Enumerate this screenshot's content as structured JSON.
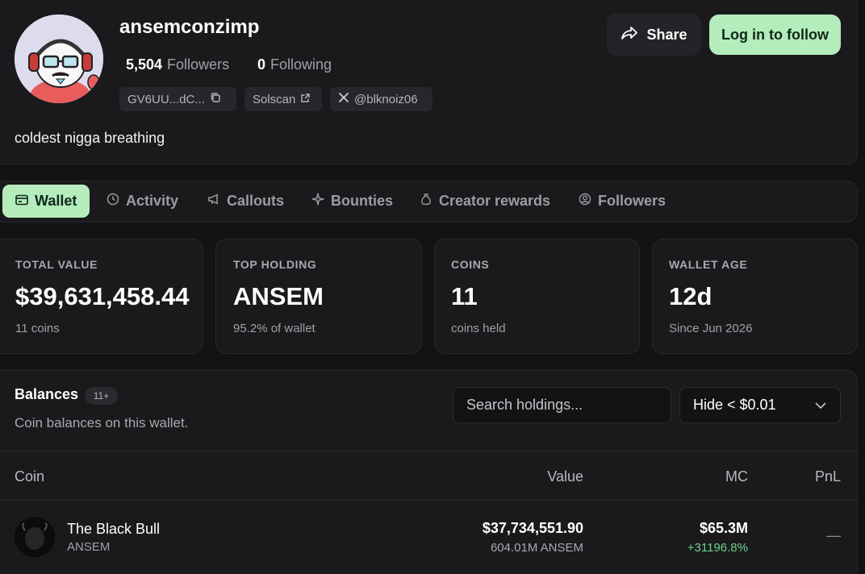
{
  "profile": {
    "username": "ansemconzimp",
    "followers_count": "5,504",
    "followers_label": "Followers",
    "following_count": "0",
    "following_label": "Following",
    "address": "GV6UU...dC...",
    "solscan_label": "Solscan",
    "x_handle": "@blknoiz06",
    "bio": "coldest nigga breathing"
  },
  "actions": {
    "share_label": "Share",
    "follow_label": "Log in to follow"
  },
  "tabs": [
    {
      "label": "Wallet",
      "icon": "wallet-icon",
      "active": true
    },
    {
      "label": "Activity",
      "icon": "clock-icon",
      "active": false
    },
    {
      "label": "Callouts",
      "icon": "megaphone-icon",
      "active": false
    },
    {
      "label": "Bounties",
      "icon": "sparkle-icon",
      "active": false
    },
    {
      "label": "Creator rewards",
      "icon": "money-bag-icon",
      "active": false
    },
    {
      "label": "Followers",
      "icon": "user-circle-icon",
      "active": false
    }
  ],
  "stats": [
    {
      "label": "TOTAL VALUE",
      "value": "$39,631,458.44",
      "sub": "11 coins"
    },
    {
      "label": "TOP HOLDING",
      "value": "ANSEM",
      "sub": "95.2% of wallet"
    },
    {
      "label": "COINS",
      "value": "11",
      "sub": "coins held"
    },
    {
      "label": "WALLET AGE",
      "value": "12d",
      "sub": "Since Jun 2026"
    }
  ],
  "balances": {
    "title": "Balances",
    "badge": "11+",
    "subtitle": "Coin balances on this wallet.",
    "search_placeholder": "Search holdings...",
    "filter_value": "Hide < $0.01",
    "columns": {
      "coin": "Coin",
      "value": "Value",
      "mc": "MC",
      "pnl": "PnL"
    },
    "rows": [
      {
        "name": "The Black Bull",
        "symbol": "ANSEM",
        "value": "$37,734,551.90",
        "amount": "604.01M ANSEM",
        "mc": "$65.3M",
        "mc_change": "+31196.8%",
        "pnl": "—"
      }
    ]
  },
  "colors": {
    "accent": "#b4ecbc",
    "positive": "#6ed38a",
    "background": "#131315",
    "card": "#1a1a1d"
  }
}
